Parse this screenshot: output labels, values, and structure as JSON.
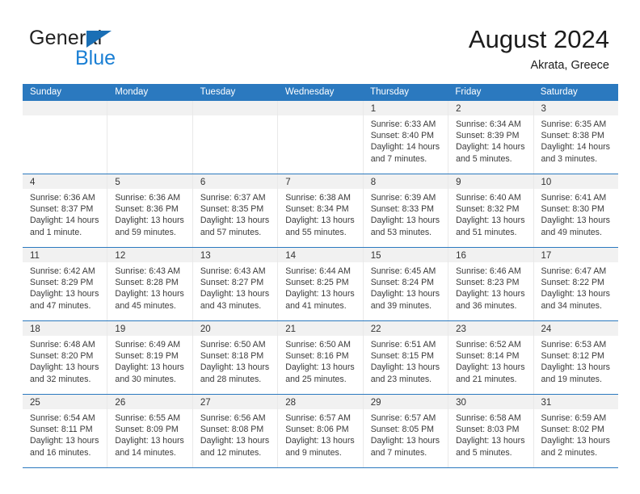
{
  "brand": {
    "name_top": "General",
    "name_bottom": "Blue",
    "triangle_color": "#1a6fb5",
    "blue_color": "#1a7fd4"
  },
  "header": {
    "title": "August 2024",
    "location": "Akrata, Greece"
  },
  "theme": {
    "header_bg": "#2b79bf",
    "header_text": "#ffffff",
    "daynum_band_bg": "#f1f1f1",
    "row_divider": "#2b79bf",
    "cell_divider": "#e9e9e9",
    "body_text": "#3a3a3a"
  },
  "calendar": {
    "weekdays": [
      "Sunday",
      "Monday",
      "Tuesday",
      "Wednesday",
      "Thursday",
      "Friday",
      "Saturday"
    ],
    "weeks": [
      [
        {
          "day": "",
          "lines": []
        },
        {
          "day": "",
          "lines": []
        },
        {
          "day": "",
          "lines": []
        },
        {
          "day": "",
          "lines": []
        },
        {
          "day": "1",
          "lines": [
            "Sunrise: 6:33 AM",
            "Sunset: 8:40 PM",
            "Daylight: 14 hours and 7 minutes."
          ]
        },
        {
          "day": "2",
          "lines": [
            "Sunrise: 6:34 AM",
            "Sunset: 8:39 PM",
            "Daylight: 14 hours and 5 minutes."
          ]
        },
        {
          "day": "3",
          "lines": [
            "Sunrise: 6:35 AM",
            "Sunset: 8:38 PM",
            "Daylight: 14 hours and 3 minutes."
          ]
        }
      ],
      [
        {
          "day": "4",
          "lines": [
            "Sunrise: 6:36 AM",
            "Sunset: 8:37 PM",
            "Daylight: 14 hours and 1 minute."
          ]
        },
        {
          "day": "5",
          "lines": [
            "Sunrise: 6:36 AM",
            "Sunset: 8:36 PM",
            "Daylight: 13 hours and 59 minutes."
          ]
        },
        {
          "day": "6",
          "lines": [
            "Sunrise: 6:37 AM",
            "Sunset: 8:35 PM",
            "Daylight: 13 hours and 57 minutes."
          ]
        },
        {
          "day": "7",
          "lines": [
            "Sunrise: 6:38 AM",
            "Sunset: 8:34 PM",
            "Daylight: 13 hours and 55 minutes."
          ]
        },
        {
          "day": "8",
          "lines": [
            "Sunrise: 6:39 AM",
            "Sunset: 8:33 PM",
            "Daylight: 13 hours and 53 minutes."
          ]
        },
        {
          "day": "9",
          "lines": [
            "Sunrise: 6:40 AM",
            "Sunset: 8:32 PM",
            "Daylight: 13 hours and 51 minutes."
          ]
        },
        {
          "day": "10",
          "lines": [
            "Sunrise: 6:41 AM",
            "Sunset: 8:30 PM",
            "Daylight: 13 hours and 49 minutes."
          ]
        }
      ],
      [
        {
          "day": "11",
          "lines": [
            "Sunrise: 6:42 AM",
            "Sunset: 8:29 PM",
            "Daylight: 13 hours and 47 minutes."
          ]
        },
        {
          "day": "12",
          "lines": [
            "Sunrise: 6:43 AM",
            "Sunset: 8:28 PM",
            "Daylight: 13 hours and 45 minutes."
          ]
        },
        {
          "day": "13",
          "lines": [
            "Sunrise: 6:43 AM",
            "Sunset: 8:27 PM",
            "Daylight: 13 hours and 43 minutes."
          ]
        },
        {
          "day": "14",
          "lines": [
            "Sunrise: 6:44 AM",
            "Sunset: 8:25 PM",
            "Daylight: 13 hours and 41 minutes."
          ]
        },
        {
          "day": "15",
          "lines": [
            "Sunrise: 6:45 AM",
            "Sunset: 8:24 PM",
            "Daylight: 13 hours and 39 minutes."
          ]
        },
        {
          "day": "16",
          "lines": [
            "Sunrise: 6:46 AM",
            "Sunset: 8:23 PM",
            "Daylight: 13 hours and 36 minutes."
          ]
        },
        {
          "day": "17",
          "lines": [
            "Sunrise: 6:47 AM",
            "Sunset: 8:22 PM",
            "Daylight: 13 hours and 34 minutes."
          ]
        }
      ],
      [
        {
          "day": "18",
          "lines": [
            "Sunrise: 6:48 AM",
            "Sunset: 8:20 PM",
            "Daylight: 13 hours and 32 minutes."
          ]
        },
        {
          "day": "19",
          "lines": [
            "Sunrise: 6:49 AM",
            "Sunset: 8:19 PM",
            "Daylight: 13 hours and 30 minutes."
          ]
        },
        {
          "day": "20",
          "lines": [
            "Sunrise: 6:50 AM",
            "Sunset: 8:18 PM",
            "Daylight: 13 hours and 28 minutes."
          ]
        },
        {
          "day": "21",
          "lines": [
            "Sunrise: 6:50 AM",
            "Sunset: 8:16 PM",
            "Daylight: 13 hours and 25 minutes."
          ]
        },
        {
          "day": "22",
          "lines": [
            "Sunrise: 6:51 AM",
            "Sunset: 8:15 PM",
            "Daylight: 13 hours and 23 minutes."
          ]
        },
        {
          "day": "23",
          "lines": [
            "Sunrise: 6:52 AM",
            "Sunset: 8:14 PM",
            "Daylight: 13 hours and 21 minutes."
          ]
        },
        {
          "day": "24",
          "lines": [
            "Sunrise: 6:53 AM",
            "Sunset: 8:12 PM",
            "Daylight: 13 hours and 19 minutes."
          ]
        }
      ],
      [
        {
          "day": "25",
          "lines": [
            "Sunrise: 6:54 AM",
            "Sunset: 8:11 PM",
            "Daylight: 13 hours and 16 minutes."
          ]
        },
        {
          "day": "26",
          "lines": [
            "Sunrise: 6:55 AM",
            "Sunset: 8:09 PM",
            "Daylight: 13 hours and 14 minutes."
          ]
        },
        {
          "day": "27",
          "lines": [
            "Sunrise: 6:56 AM",
            "Sunset: 8:08 PM",
            "Daylight: 13 hours and 12 minutes."
          ]
        },
        {
          "day": "28",
          "lines": [
            "Sunrise: 6:57 AM",
            "Sunset: 8:06 PM",
            "Daylight: 13 hours and 9 minutes."
          ]
        },
        {
          "day": "29",
          "lines": [
            "Sunrise: 6:57 AM",
            "Sunset: 8:05 PM",
            "Daylight: 13 hours and 7 minutes."
          ]
        },
        {
          "day": "30",
          "lines": [
            "Sunrise: 6:58 AM",
            "Sunset: 8:03 PM",
            "Daylight: 13 hours and 5 minutes."
          ]
        },
        {
          "day": "31",
          "lines": [
            "Sunrise: 6:59 AM",
            "Sunset: 8:02 PM",
            "Daylight: 13 hours and 2 minutes."
          ]
        }
      ]
    ]
  }
}
